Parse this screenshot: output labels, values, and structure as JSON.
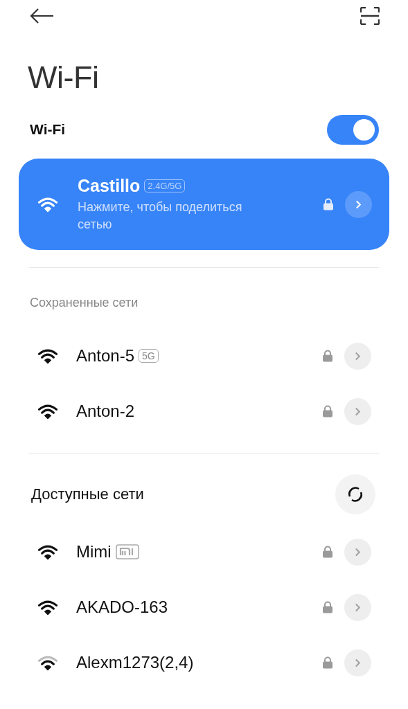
{
  "title": "Wi-Fi",
  "wifi_toggle": {
    "label": "Wi-Fi",
    "on": true
  },
  "connected": {
    "name": "Castillo",
    "band": "2.4G/5G",
    "subtitle": "Нажмите, чтобы поделиться сетью",
    "locked": true
  },
  "saved": {
    "heading": "Сохраненные сети",
    "networks": [
      {
        "name": "Anton-5",
        "band": "5G",
        "locked": true,
        "weak_signal": false
      },
      {
        "name": "Anton-2",
        "locked": true,
        "weak_signal": false
      }
    ]
  },
  "available": {
    "heading": "Доступные сети",
    "networks": [
      {
        "name": "Mimi",
        "mi_badge": true,
        "locked": true,
        "weak_signal": false
      },
      {
        "name": "AKADO-163",
        "locked": true,
        "weak_signal": false
      },
      {
        "name": "Alexm1273(2,4)",
        "locked": true,
        "weak_signal": true
      }
    ]
  }
}
